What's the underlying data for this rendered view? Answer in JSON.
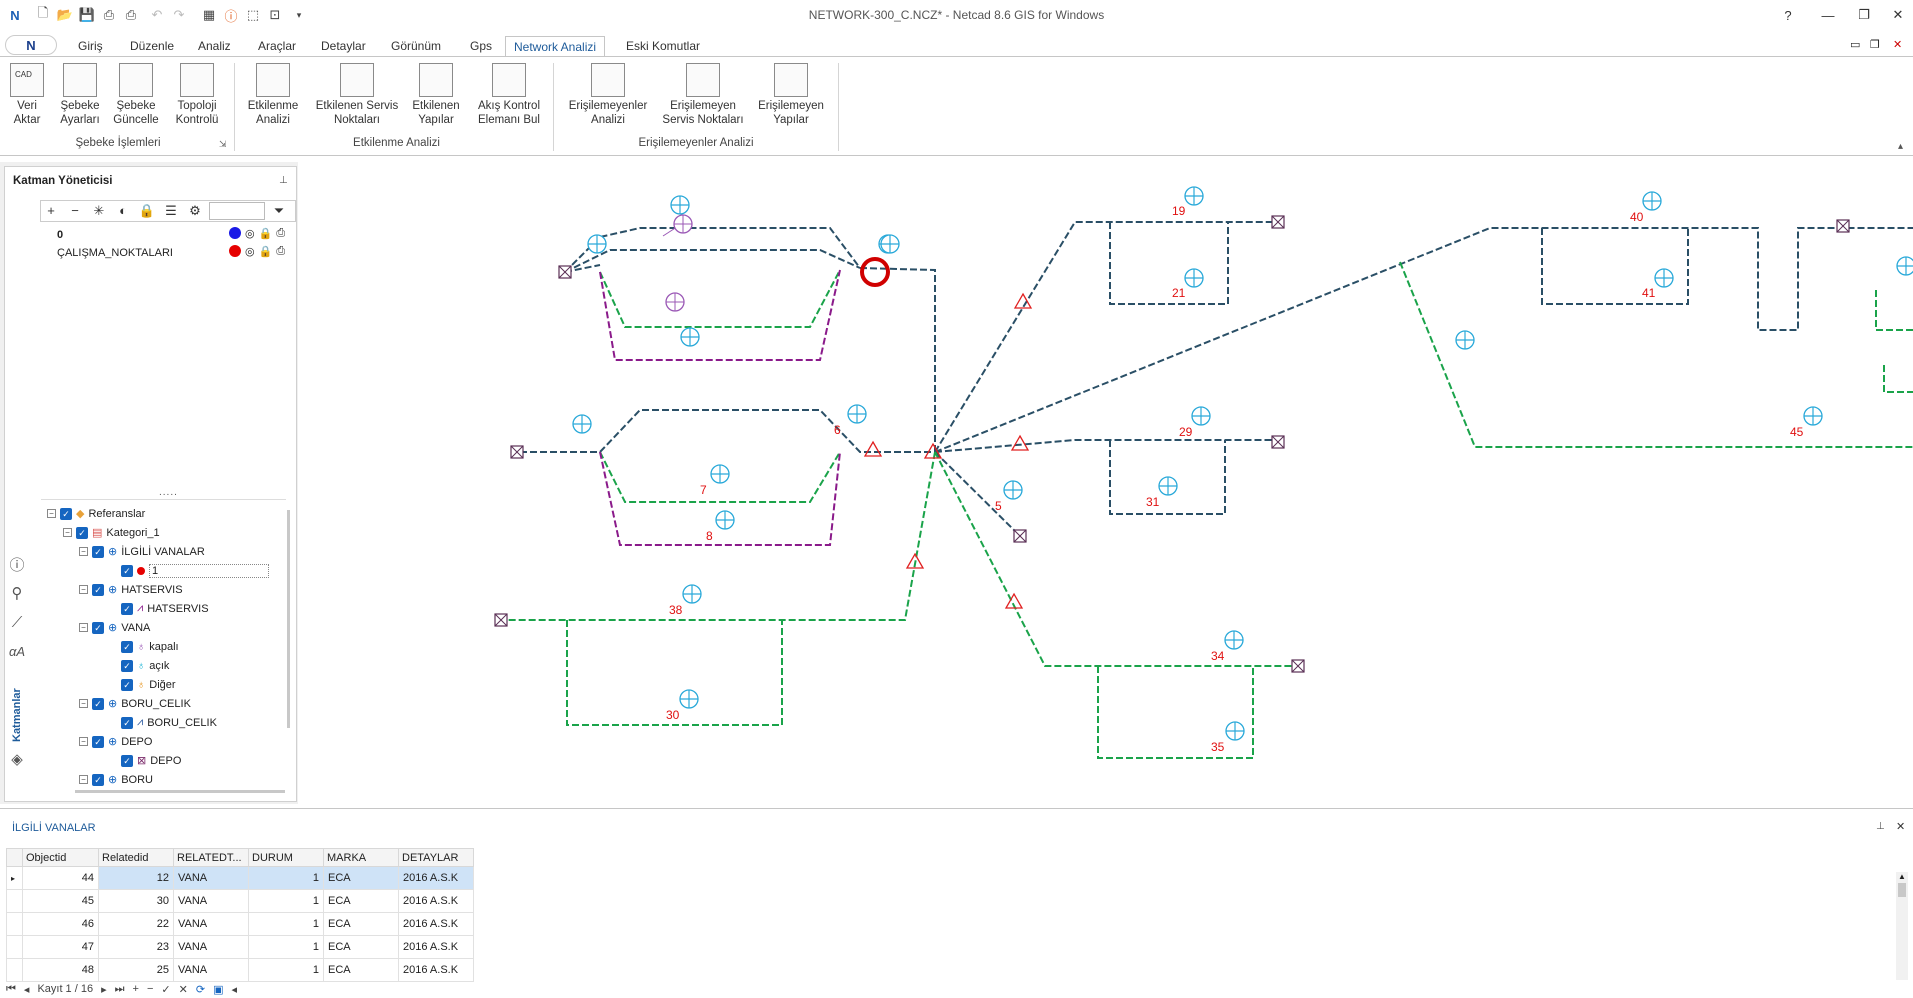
{
  "window": {
    "title": "NETWORK-300_C.NCZ* - Netcad 8.6 GIS for Windows"
  },
  "ribbon_tabs": [
    "Giriş",
    "Düzenle",
    "Analiz",
    "Araçlar",
    "Detaylar",
    "Görünüm",
    "Gps",
    "Network Analizi",
    "Eski Komutlar"
  ],
  "ribbon": {
    "groups": [
      "Şebeke İşlemleri",
      "Etkilenme Analizi",
      "Erişilemeyenler Analizi"
    ],
    "buttons": [
      {
        "l1": "Veri",
        "l2": "Aktar",
        "icon": "import-cad-icon"
      },
      {
        "l1": "Şebeke",
        "l2": "Ayarları",
        "icon": "network-settings-icon"
      },
      {
        "l1": "Şebeke",
        "l2": "Güncelle",
        "icon": "network-update-icon"
      },
      {
        "l1": "Topoloji",
        "l2": "Kontrolü",
        "icon": "topology-check-icon"
      },
      {
        "l1": "Etkilenme",
        "l2": "Analizi",
        "icon": "impact-analysis-icon"
      },
      {
        "l1": "Etkilenen Servis",
        "l2": "Noktaları",
        "icon": "affected-service-icon"
      },
      {
        "l1": "Etkilenen",
        "l2": "Yapılar",
        "icon": "affected-buildings-icon"
      },
      {
        "l1": "Akış Kontrol",
        "l2": "Elemanı Bul",
        "icon": "flow-control-icon"
      },
      {
        "l1": "Erişilemeyenler",
        "l2": "Analizi",
        "icon": "unreachable-analysis-icon"
      },
      {
        "l1": "Erişilemeyen",
        "l2": "Servis Noktaları",
        "icon": "unreachable-service-icon"
      },
      {
        "l1": "Erişilemeyen",
        "l2": "Yapılar",
        "icon": "unreachable-buildings-icon"
      }
    ]
  },
  "layer_manager": {
    "title": "Katman Yöneticisi",
    "layers": [
      {
        "name": "0",
        "color": "#1a1ae6"
      },
      {
        "name": "ÇALIŞMA_NOKTALARI",
        "color": "#e60000"
      }
    ],
    "dots": ".....",
    "tree": [
      {
        "label": "Referanslar",
        "level": 0
      },
      {
        "label": "Kategori_1",
        "level": 1
      },
      {
        "label": "İLGİLİ VANALAR",
        "level": 2
      },
      {
        "label": "1",
        "level": 3
      },
      {
        "label": "HATSERVIS",
        "level": 2
      },
      {
        "label": "HATSERVIS",
        "level": 3
      },
      {
        "label": "VANA",
        "level": 2
      },
      {
        "label": "kapalı",
        "level": 3
      },
      {
        "label": "açık",
        "level": 3
      },
      {
        "label": "Diğer",
        "level": 3
      },
      {
        "label": "BORU_CELIK",
        "level": 2
      },
      {
        "label": "BORU_CELIK",
        "level": 3
      },
      {
        "label": "DEPO",
        "level": 2
      },
      {
        "label": "DEPO",
        "level": 3
      },
      {
        "label": "BORU",
        "level": 2
      }
    ],
    "side_tab": "Katmanlar"
  },
  "map": {
    "valve_labels": [
      "19",
      "21",
      "40",
      "41",
      "29",
      "31",
      "45",
      "5",
      "7",
      "8",
      "38",
      "30",
      "34",
      "35",
      "6"
    ]
  },
  "table": {
    "title": "İLGİLİ VANALAR",
    "columns": [
      "Objectid",
      "Relatedid",
      "RELATEDT...",
      "DURUM",
      "MARKA",
      "DETAYLAR"
    ],
    "rows": [
      [
        "44",
        "12",
        "VANA",
        "1",
        "ECA",
        "2016 A.S.K"
      ],
      [
        "45",
        "30",
        "VANA",
        "1",
        "ECA",
        "2016 A.S.K"
      ],
      [
        "46",
        "22",
        "VANA",
        "1",
        "ECA",
        "2016 A.S.K"
      ],
      [
        "47",
        "23",
        "VANA",
        "1",
        "ECA",
        "2016 A.S.K"
      ],
      [
        "48",
        "25",
        "VANA",
        "1",
        "ECA",
        "2016 A.S.K"
      ]
    ],
    "record_nav": "Kayıt 1 / 16"
  }
}
